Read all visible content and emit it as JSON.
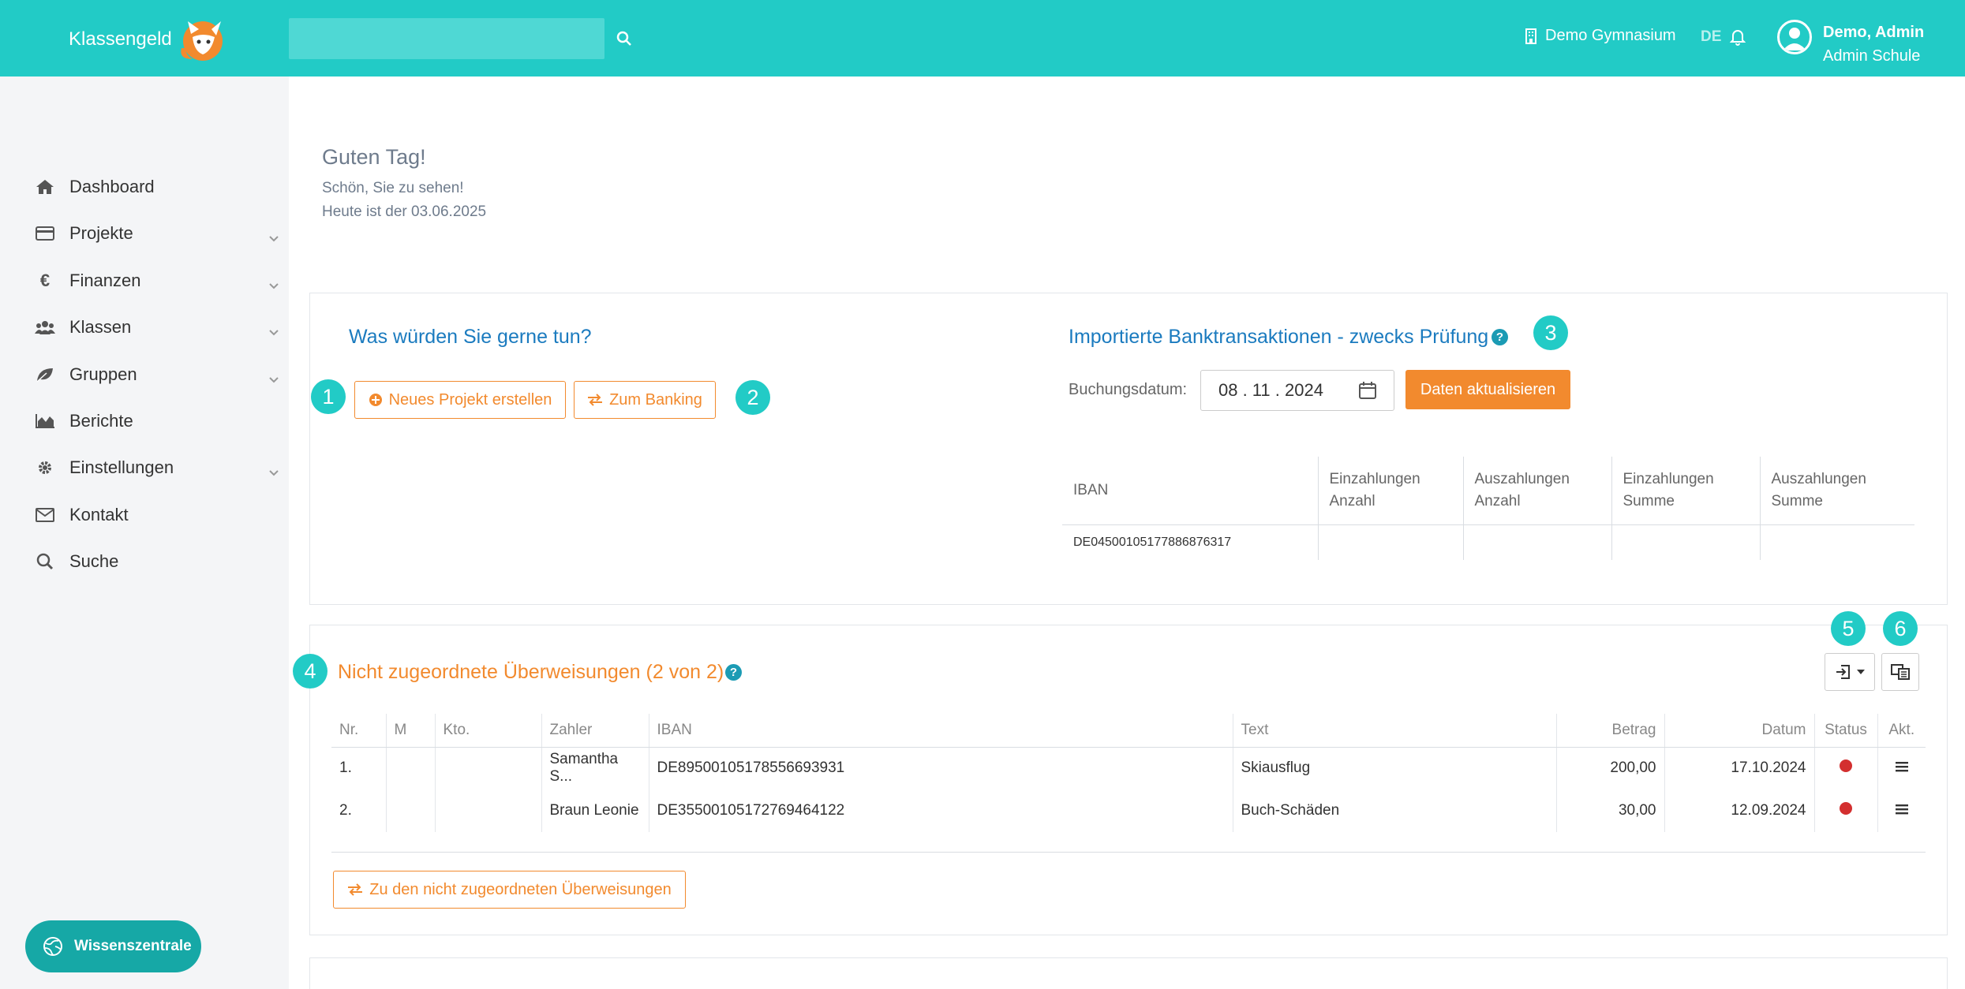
{
  "header": {
    "logo_text": "Klassengeld",
    "school": "Demo Gymnasium",
    "lang": "DE",
    "user_name": "Demo, Admin",
    "user_role": "Admin Schule",
    "search_placeholder": ""
  },
  "sidebar": {
    "items": [
      {
        "label": "Dashboard",
        "icon": "home-icon"
      },
      {
        "label": "Projekte",
        "icon": "credit-card-icon"
      },
      {
        "label": "Finanzen",
        "icon": "euro-icon"
      },
      {
        "label": "Klassen",
        "icon": "users-icon"
      },
      {
        "label": "Gruppen",
        "icon": "leaf-icon"
      },
      {
        "label": "Berichte",
        "icon": "area-chart-icon"
      },
      {
        "label": "Einstellungen",
        "icon": "gear-icon"
      },
      {
        "label": "Kontakt",
        "icon": "envelope-icon"
      },
      {
        "label": "Suche",
        "icon": "search-icon"
      }
    ],
    "help_button": "Wissenszentrale"
  },
  "greeting": {
    "title": "Guten Tag!",
    "subtitle": "Schön, Sie zu sehen!",
    "date_line": "Heute ist der 03.06.2025"
  },
  "actions": {
    "title": "Was würden Sie gerne tun?",
    "new_project": "Neues Projekt erstellen",
    "banking": "Zum Banking"
  },
  "bank": {
    "title": "Importierte Banktransaktionen - zwecks Prüfung",
    "date_label": "Buchungsdatum:",
    "date_value": "08 . 11 . 2024",
    "refresh": "Daten aktualisieren",
    "columns": [
      "IBAN",
      "Einzahlungen Anzahl",
      "Auszahlungen Anzahl",
      "Einzahlungen Summe",
      "Auszahlungen Summe"
    ],
    "rows": [
      [
        "DE04500105177886876317",
        "",
        "",
        "",
        ""
      ]
    ]
  },
  "transfers": {
    "title": "Nicht zugeordnete Überweisungen (2 von 2)",
    "columns": [
      "Nr.",
      "M",
      "Kto.",
      "Zahler",
      "IBAN",
      "Text",
      "Betrag",
      "Datum",
      "Status",
      "Akt."
    ],
    "rows": [
      {
        "nr": "1.",
        "m": "",
        "kto": "",
        "zahler": "Samantha S...",
        "iban": "DE89500105178556693931",
        "text": "Skiausflug",
        "betrag": "200,00",
        "datum": "17.10.2024"
      },
      {
        "nr": "2.",
        "m": "",
        "kto": "",
        "zahler": "Braun Leonie",
        "iban": "DE35500105172769464122",
        "text": "Buch-Schäden",
        "betrag": "30,00",
        "datum": "12.09.2024"
      }
    ],
    "link_button": "Zu den nicht zugeordneten Überweisungen"
  },
  "badges": [
    "1",
    "2",
    "3",
    "4",
    "5",
    "6"
  ],
  "colors": {
    "brand": "#22cbc6",
    "accent": "#f28a2e",
    "title_blue": "#1b7bbf",
    "status_red": "#d32f2f"
  }
}
